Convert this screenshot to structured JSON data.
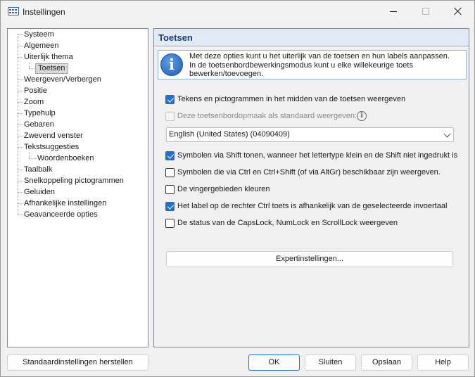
{
  "window": {
    "title": "Instellingen",
    "icon": "keyboard-icon"
  },
  "tree": {
    "items": [
      {
        "label": "Systeem"
      },
      {
        "label": "Algemeen"
      },
      {
        "label": "Uiterlijk thema"
      },
      {
        "label": "Toetsen",
        "selected": true
      },
      {
        "label": "Weergeven/Verbergen"
      },
      {
        "label": "Positie"
      },
      {
        "label": "Zoom"
      },
      {
        "label": "Typehulp"
      },
      {
        "label": "Gebaren"
      },
      {
        "label": "Zwevend venster"
      },
      {
        "label": "Tekstsuggesties"
      },
      {
        "label": "Woordenboeken"
      },
      {
        "label": "Taalbalk"
      },
      {
        "label": "Snelkoppeling pictogrammen"
      },
      {
        "label": "Geluiden"
      },
      {
        "label": "Afhankelijke instellingen"
      },
      {
        "label": "Geavanceerde opties"
      }
    ]
  },
  "panel": {
    "title": "Toetsen",
    "info_icon": "info-icon",
    "info_lines": [
      "Met deze opties kunt u het uiterlijk van de toetsen en hun labels aanpassen.",
      "In de toetsenbordbewerkingsmodus kunt u elke willekeurige toets",
      "bewerken/toevoegen."
    ],
    "options": [
      {
        "label": "Tekens en pictogrammen in het midden van de toetsen weergeven",
        "checked": true,
        "enabled": true
      },
      {
        "label": "Deze toetsenbordopmaak als standaard weergeven:",
        "checked": false,
        "enabled": false
      },
      {
        "label": "Symbolen via Shift tonen, wanneer het lettertype klein en de Shift niet ingedrukt is",
        "checked": true,
        "enabled": true
      },
      {
        "label": "Symbolen die via Ctrl en Ctrl+Shift (of via AltGr) beschikbaar zijn weergeven.",
        "checked": false,
        "enabled": true
      },
      {
        "label": "De vingergebieden kleuren",
        "checked": false,
        "enabled": true
      },
      {
        "label": "Het label op de rechter Ctrl toets is afhankelijk van de geselecteerde invoertaal",
        "checked": true,
        "enabled": true
      },
      {
        "label": "De status van de CapsLock, NumLock en ScrollLock weergeven",
        "checked": false,
        "enabled": true
      }
    ],
    "layout_select_value": "English (United States) (04090409)",
    "expert_button": "Expertinstellingen..."
  },
  "footer": {
    "reset_label": "Standaardinstellingen herstellen",
    "ok_label": "OK",
    "close_label": "Sluiten",
    "save_label": "Opslaan",
    "help_label": "Help"
  },
  "colors": {
    "accent": "#1f6fcf",
    "header_bg": "#e1ebf6",
    "header_title": "#1a3f70"
  }
}
